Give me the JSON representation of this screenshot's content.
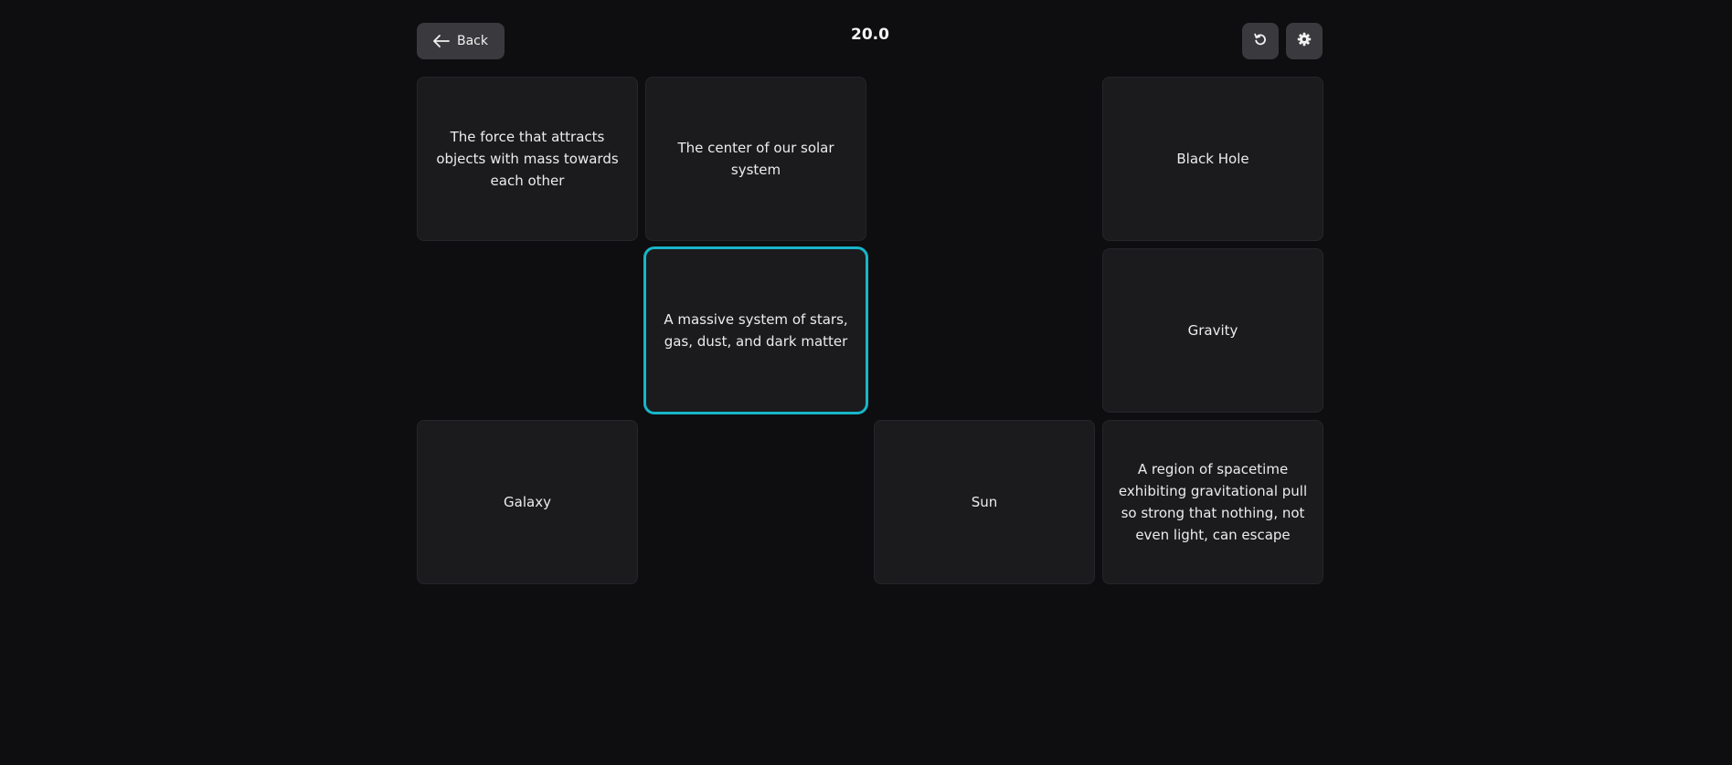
{
  "header": {
    "back_label": "Back",
    "timer": "20.0",
    "back_icon": "arrow-left-icon",
    "undo_icon": "undo-icon",
    "settings_icon": "gear-icon"
  },
  "colors": {
    "background": "#0e0e10",
    "tile": "#1b1b1e",
    "button": "#3a3a3e",
    "selected_border": "#17b6c8"
  },
  "board": {
    "tiles": [
      {
        "row": 1,
        "col": 1,
        "text": "The force that attracts objects with mass towards each other",
        "selected": false
      },
      {
        "row": 1,
        "col": 2,
        "text": "The center of our solar system",
        "selected": false
      },
      {
        "row": 1,
        "col": 4,
        "text": "Black Hole",
        "selected": false
      },
      {
        "row": 2,
        "col": 2,
        "text": "A massive system of stars, gas, dust, and dark matter",
        "selected": true
      },
      {
        "row": 2,
        "col": 4,
        "text": "Gravity",
        "selected": false
      },
      {
        "row": 3,
        "col": 1,
        "text": "Galaxy",
        "selected": false
      },
      {
        "row": 3,
        "col": 3,
        "text": "Sun",
        "selected": false
      },
      {
        "row": 3,
        "col": 4,
        "text": "A region of spacetime exhibiting gravitational pull so strong that nothing, not even light, can escape",
        "selected": false
      }
    ]
  }
}
